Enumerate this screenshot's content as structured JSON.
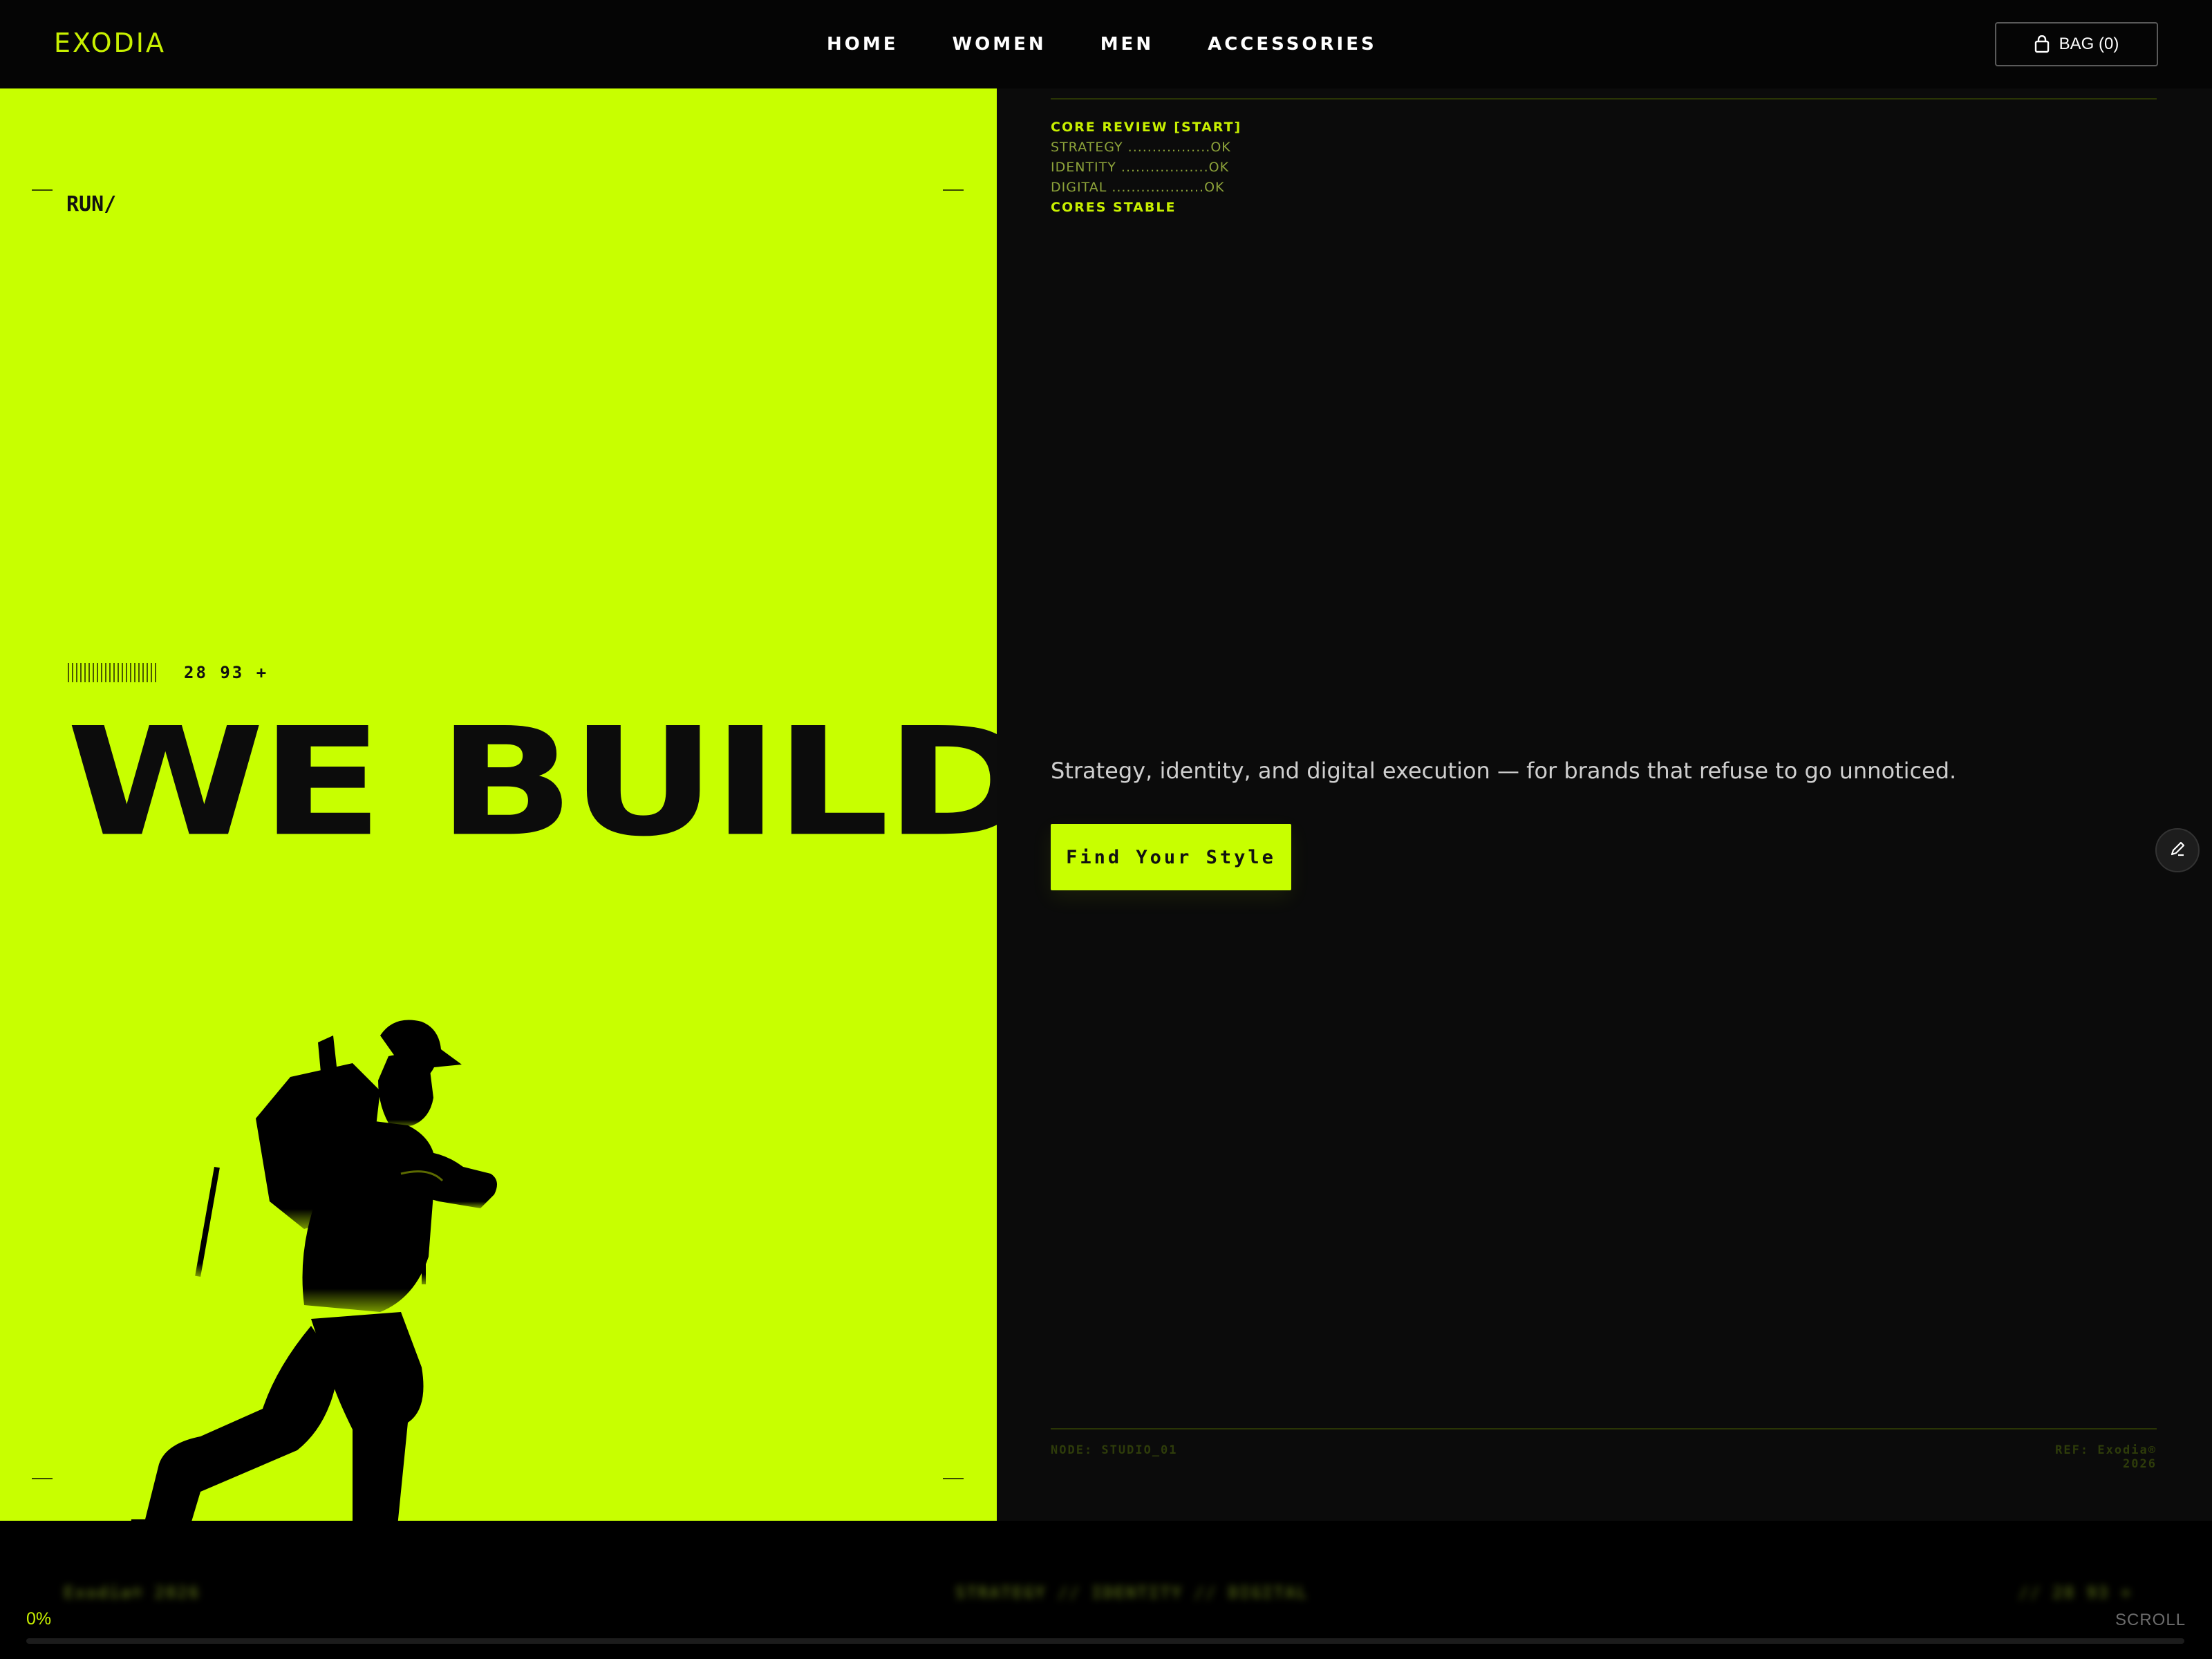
{
  "header": {
    "logo": "EXODIA",
    "nav": [
      "HOME",
      "WOMEN",
      "MEN",
      "ACCESSORIES"
    ],
    "bag_label": "BAG (0)"
  },
  "hero": {
    "run_label": "RUN/",
    "counter": "28 93 +",
    "headline": "WE BUILD"
  },
  "core_review": {
    "title": "CORE REVIEW [START]",
    "items": [
      "STRATEGY .................OK",
      "IDENTITY ..................OK",
      "DIGITAL ...................OK"
    ],
    "status": "CORES STABLE"
  },
  "panel": {
    "tagline": "Strategy, identity, and digital execution — for brands that refuse to go unnoticed.",
    "cta_label": "Find Your Style",
    "node": "NODE: STUDIO_01",
    "ref": "REF: Exodia® 2026"
  },
  "footer": {
    "blur_left": "Exodia® 2026",
    "blur_center": "STRATEGY // IDENTITY // DIGITAL",
    "blur_right": "// 28 93 +",
    "progress_label": "0%",
    "progress_value": 0,
    "scroll_label": "SCROLL"
  },
  "colors": {
    "accent": "#c8ff00",
    "panel_bg": "#0b0b0b",
    "background": "#000000"
  }
}
